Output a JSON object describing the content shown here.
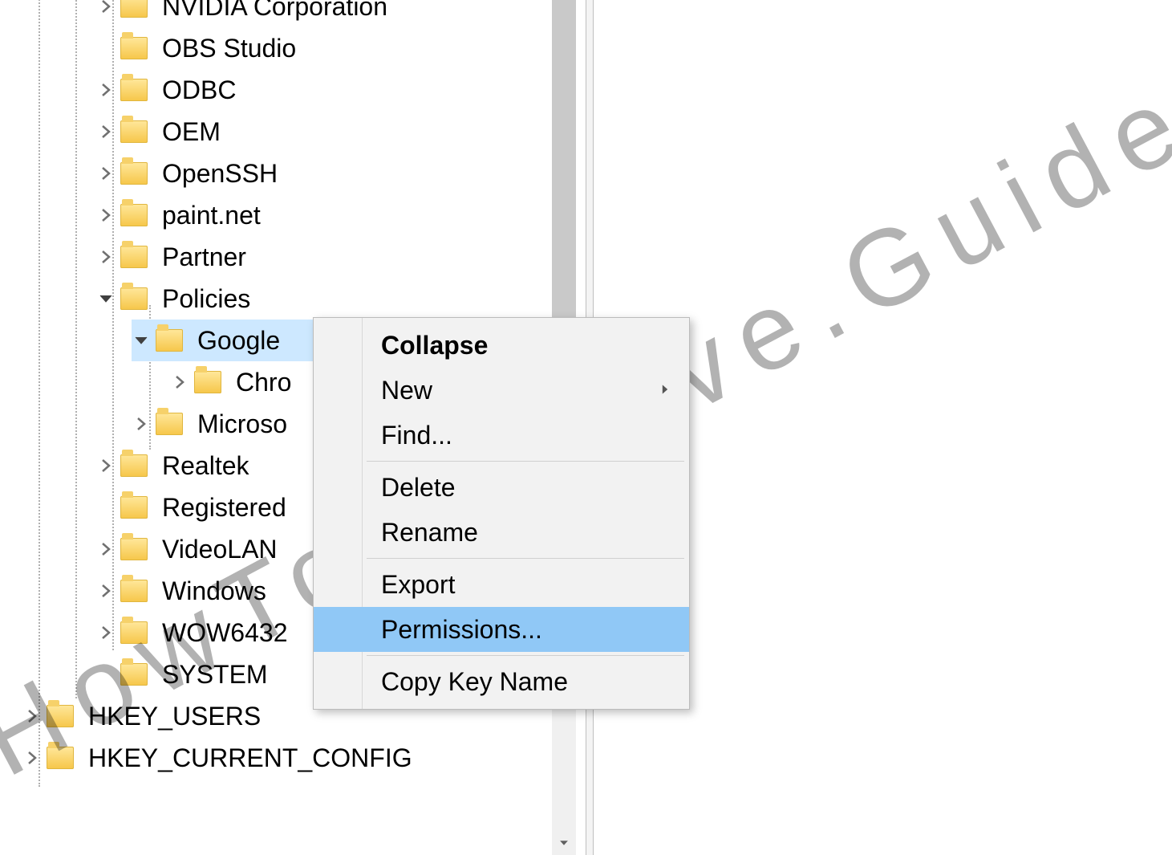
{
  "watermark": "HowToRemove.Guide",
  "tree": {
    "nvidia": "NVIDIA Corporation",
    "obs": "OBS Studio",
    "odbc": "ODBC",
    "oem": "OEM",
    "openssh": "OpenSSH",
    "paintnet": "paint.net",
    "partner": "Partner",
    "policies": "Policies",
    "google": "Google",
    "chro": "Chro",
    "microso": "Microso",
    "realtek": "Realtek",
    "registered": "Registered",
    "videolan": "VideoLAN",
    "windows": "Windows",
    "wow6432": "WOW6432",
    "system": "SYSTEM",
    "hkey_users": "HKEY_USERS",
    "hkey_current": "HKEY_CURRENT_CONFIG"
  },
  "menu": {
    "collapse": "Collapse",
    "new": "New",
    "find": "Find...",
    "delete": "Delete",
    "rename": "Rename",
    "export": "Export",
    "permissions": "Permissions...",
    "copy_key": "Copy Key Name"
  }
}
